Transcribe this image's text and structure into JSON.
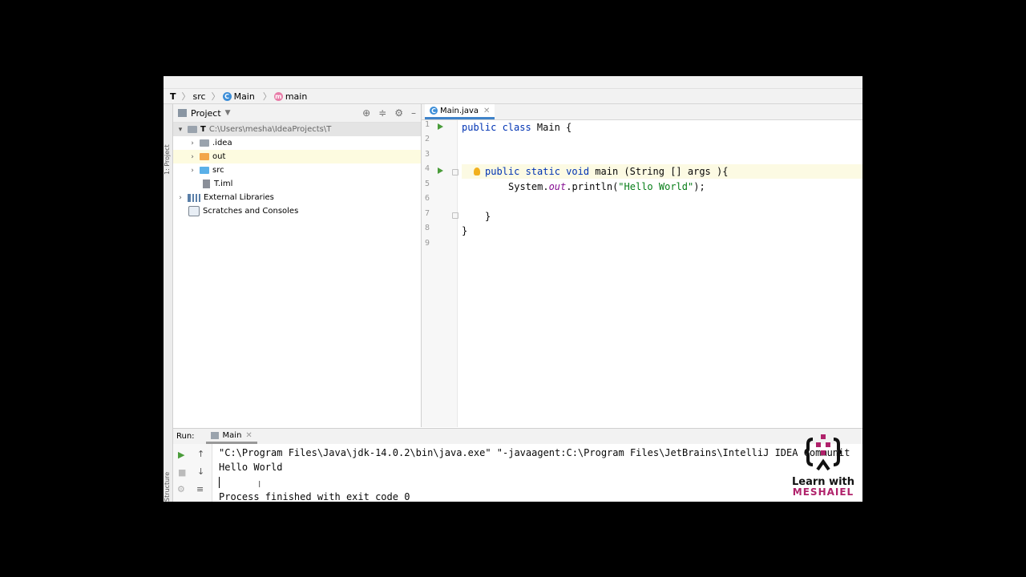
{
  "breadcrumb": {
    "project": "T",
    "folder": "src",
    "class": "Main",
    "method": "main",
    "class_badge": "C",
    "method_badge": "m"
  },
  "sidebar": {
    "project_label": "1: Project",
    "structure_label": "Structure"
  },
  "project_panel": {
    "title": "Project",
    "root_name": "T",
    "root_path": "C:\\Users\\mesha\\IdeaProjects\\T",
    "items": [
      {
        "label": ".idea"
      },
      {
        "label": "out"
      },
      {
        "label": "src"
      },
      {
        "label": "T.iml"
      },
      {
        "label": "External Libraries"
      },
      {
        "label": "Scratches and Consoles"
      }
    ]
  },
  "editor": {
    "tab_label": "Main.java",
    "line_numbers": [
      "1",
      "2",
      "3",
      "4",
      "5",
      "6",
      "7",
      "8",
      "9"
    ],
    "code": {
      "l1_kw": "public class",
      "l1_rest": " Main {",
      "l4_kw": "public static void",
      "l4_rest": " main (String [] args ){",
      "l5_pre": "System.",
      "l5_out": "out",
      "l5_mid": ".println(",
      "l5_str": "\"Hello World\"",
      "l5_end": ");",
      "l7": "}",
      "l8": "}"
    }
  },
  "run_panel": {
    "label": "Run:",
    "tab_label": "Main",
    "lines": [
      "\"C:\\Program Files\\Java\\jdk-14.0.2\\bin\\java.exe\" \"-javaagent:C:\\Program Files\\JetBrains\\IntelliJ IDEA Communit",
      "Hello World",
      "Process finished with exit code 0"
    ]
  },
  "watermark": {
    "line1": "Learn with",
    "line2": "MESHAIEL"
  },
  "colors": {
    "keyword": "#0033b3",
    "string": "#067d17",
    "field": "#871094",
    "run_green": "#4a9c3a",
    "brand": "#b0226b"
  }
}
